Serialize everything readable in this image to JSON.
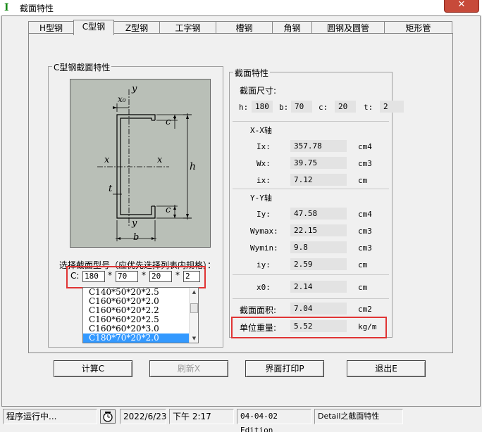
{
  "window": {
    "title": "截面特性",
    "close_label": "✕"
  },
  "tabs": [
    {
      "label": "H型钢"
    },
    {
      "label": "C型钢"
    },
    {
      "label": "Z型钢"
    },
    {
      "label": "工字钢"
    },
    {
      "label": "槽钢"
    },
    {
      "label": "角钢"
    },
    {
      "label": "圆钢及圆管"
    },
    {
      "label": "矩形管"
    }
  ],
  "left_group": {
    "title": "C型钢截面特性",
    "drawing_labels": {
      "y_top": "y",
      "x0": "x₀",
      "c_top": "c",
      "x_left": "x",
      "x_right": "x",
      "h": "h",
      "t": "t",
      "c_bottom": "c",
      "y_bottom": "y",
      "b": "b"
    },
    "select_label": "选择截面型号（应优先选择列表内规格）：",
    "c_prefix": "C:",
    "star": "*",
    "inputs": {
      "h": "180",
      "b": "70",
      "c": "20",
      "t": "2"
    },
    "list_items": [
      "C140*50*20*2.5",
      "C160*60*20*2.0",
      "C160*60*20*2.2",
      "C160*60*20*2.5",
      "C160*60*20*3.0",
      "C180*70*20*2.0"
    ],
    "selected_index": 5
  },
  "props": {
    "title": "截面特性",
    "dim_title": "截面尺寸:",
    "dims": [
      {
        "label": "h:",
        "value": "180"
      },
      {
        "label": "b:",
        "value": "70"
      },
      {
        "label": "c:",
        "value": "20"
      },
      {
        "label": "t:",
        "value": "2"
      }
    ],
    "xx_title": "X-X轴",
    "xx": [
      {
        "label": "Ix:",
        "value": "357.78",
        "unit": "cm4"
      },
      {
        "label": "Wx:",
        "value": "39.75",
        "unit": "cm3"
      },
      {
        "label": "ix:",
        "value": "7.12",
        "unit": "cm"
      }
    ],
    "yy_title": "Y-Y轴",
    "yy": [
      {
        "label": "Iy:",
        "value": "47.58",
        "unit": "cm4"
      },
      {
        "label": "Wymax:",
        "value": "22.15",
        "unit": "cm3"
      },
      {
        "label": "Wymin:",
        "value": "9.8",
        "unit": "cm3"
      },
      {
        "label": "iy:",
        "value": "2.59",
        "unit": "cm"
      }
    ],
    "x0": {
      "label": "x0:",
      "value": "2.14",
      "unit": "cm"
    },
    "area": {
      "label": "截面面积:",
      "value": "7.04",
      "unit": "cm2"
    },
    "weight": {
      "label": "单位重量:",
      "value": "5.52",
      "unit": "kg/m"
    }
  },
  "buttons": {
    "calc": "计算C",
    "refresh": "刷新X",
    "print": "界面打印P",
    "exit": "退出E"
  },
  "status": {
    "running": "程序运行中...",
    "date": "2022/6/23",
    "time": "下午 2:17",
    "edition": "04-04-02 Edition",
    "module": "Detail之截面特性"
  },
  "colors": {
    "highlight_box": "#e03434",
    "selection": "#3399ff",
    "drawing_bg": "#b9bfb7"
  }
}
